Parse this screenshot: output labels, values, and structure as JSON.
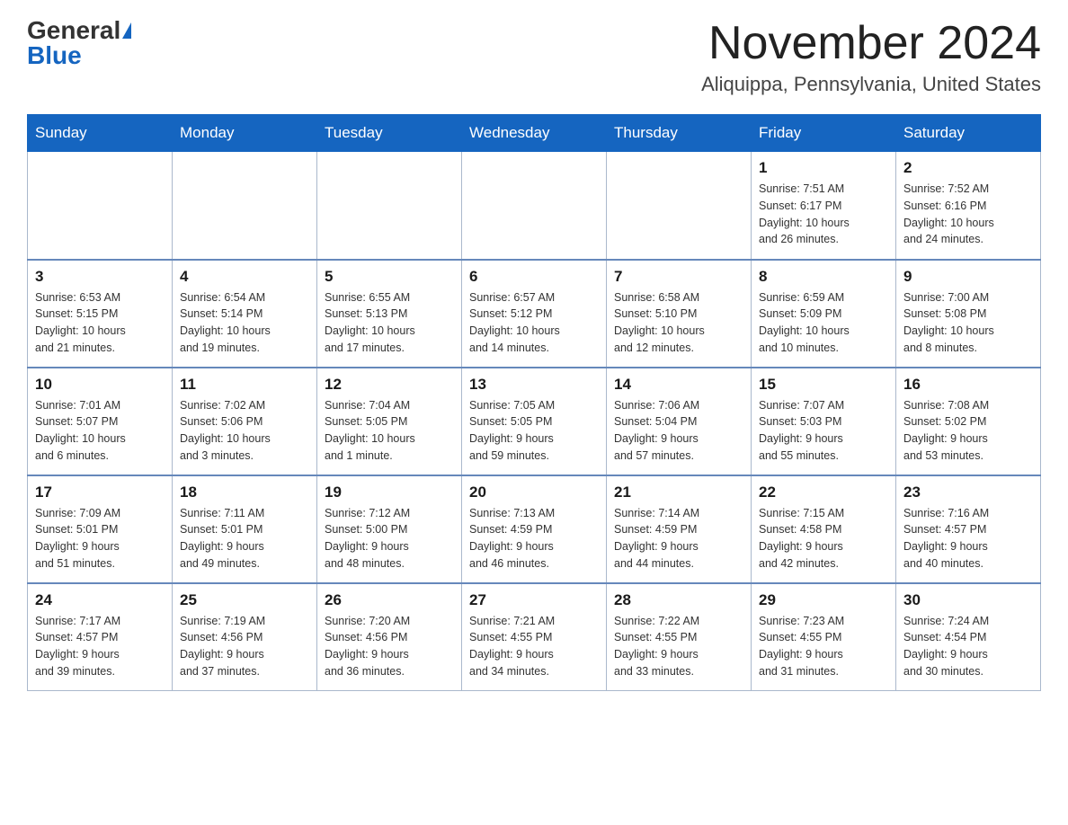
{
  "header": {
    "logo_general": "General",
    "logo_blue": "Blue",
    "month_title": "November 2024",
    "location": "Aliquippa, Pennsylvania, United States"
  },
  "weekdays": [
    "Sunday",
    "Monday",
    "Tuesday",
    "Wednesday",
    "Thursday",
    "Friday",
    "Saturday"
  ],
  "weeks": [
    [
      {
        "day": "",
        "info": ""
      },
      {
        "day": "",
        "info": ""
      },
      {
        "day": "",
        "info": ""
      },
      {
        "day": "",
        "info": ""
      },
      {
        "day": "",
        "info": ""
      },
      {
        "day": "1",
        "info": "Sunrise: 7:51 AM\nSunset: 6:17 PM\nDaylight: 10 hours\nand 26 minutes."
      },
      {
        "day": "2",
        "info": "Sunrise: 7:52 AM\nSunset: 6:16 PM\nDaylight: 10 hours\nand 24 minutes."
      }
    ],
    [
      {
        "day": "3",
        "info": "Sunrise: 6:53 AM\nSunset: 5:15 PM\nDaylight: 10 hours\nand 21 minutes."
      },
      {
        "day": "4",
        "info": "Sunrise: 6:54 AM\nSunset: 5:14 PM\nDaylight: 10 hours\nand 19 minutes."
      },
      {
        "day": "5",
        "info": "Sunrise: 6:55 AM\nSunset: 5:13 PM\nDaylight: 10 hours\nand 17 minutes."
      },
      {
        "day": "6",
        "info": "Sunrise: 6:57 AM\nSunset: 5:12 PM\nDaylight: 10 hours\nand 14 minutes."
      },
      {
        "day": "7",
        "info": "Sunrise: 6:58 AM\nSunset: 5:10 PM\nDaylight: 10 hours\nand 12 minutes."
      },
      {
        "day": "8",
        "info": "Sunrise: 6:59 AM\nSunset: 5:09 PM\nDaylight: 10 hours\nand 10 minutes."
      },
      {
        "day": "9",
        "info": "Sunrise: 7:00 AM\nSunset: 5:08 PM\nDaylight: 10 hours\nand 8 minutes."
      }
    ],
    [
      {
        "day": "10",
        "info": "Sunrise: 7:01 AM\nSunset: 5:07 PM\nDaylight: 10 hours\nand 6 minutes."
      },
      {
        "day": "11",
        "info": "Sunrise: 7:02 AM\nSunset: 5:06 PM\nDaylight: 10 hours\nand 3 minutes."
      },
      {
        "day": "12",
        "info": "Sunrise: 7:04 AM\nSunset: 5:05 PM\nDaylight: 10 hours\nand 1 minute."
      },
      {
        "day": "13",
        "info": "Sunrise: 7:05 AM\nSunset: 5:05 PM\nDaylight: 9 hours\nand 59 minutes."
      },
      {
        "day": "14",
        "info": "Sunrise: 7:06 AM\nSunset: 5:04 PM\nDaylight: 9 hours\nand 57 minutes."
      },
      {
        "day": "15",
        "info": "Sunrise: 7:07 AM\nSunset: 5:03 PM\nDaylight: 9 hours\nand 55 minutes."
      },
      {
        "day": "16",
        "info": "Sunrise: 7:08 AM\nSunset: 5:02 PM\nDaylight: 9 hours\nand 53 minutes."
      }
    ],
    [
      {
        "day": "17",
        "info": "Sunrise: 7:09 AM\nSunset: 5:01 PM\nDaylight: 9 hours\nand 51 minutes."
      },
      {
        "day": "18",
        "info": "Sunrise: 7:11 AM\nSunset: 5:01 PM\nDaylight: 9 hours\nand 49 minutes."
      },
      {
        "day": "19",
        "info": "Sunrise: 7:12 AM\nSunset: 5:00 PM\nDaylight: 9 hours\nand 48 minutes."
      },
      {
        "day": "20",
        "info": "Sunrise: 7:13 AM\nSunset: 4:59 PM\nDaylight: 9 hours\nand 46 minutes."
      },
      {
        "day": "21",
        "info": "Sunrise: 7:14 AM\nSunset: 4:59 PM\nDaylight: 9 hours\nand 44 minutes."
      },
      {
        "day": "22",
        "info": "Sunrise: 7:15 AM\nSunset: 4:58 PM\nDaylight: 9 hours\nand 42 minutes."
      },
      {
        "day": "23",
        "info": "Sunrise: 7:16 AM\nSunset: 4:57 PM\nDaylight: 9 hours\nand 40 minutes."
      }
    ],
    [
      {
        "day": "24",
        "info": "Sunrise: 7:17 AM\nSunset: 4:57 PM\nDaylight: 9 hours\nand 39 minutes."
      },
      {
        "day": "25",
        "info": "Sunrise: 7:19 AM\nSunset: 4:56 PM\nDaylight: 9 hours\nand 37 minutes."
      },
      {
        "day": "26",
        "info": "Sunrise: 7:20 AM\nSunset: 4:56 PM\nDaylight: 9 hours\nand 36 minutes."
      },
      {
        "day": "27",
        "info": "Sunrise: 7:21 AM\nSunset: 4:55 PM\nDaylight: 9 hours\nand 34 minutes."
      },
      {
        "day": "28",
        "info": "Sunrise: 7:22 AM\nSunset: 4:55 PM\nDaylight: 9 hours\nand 33 minutes."
      },
      {
        "day": "29",
        "info": "Sunrise: 7:23 AM\nSunset: 4:55 PM\nDaylight: 9 hours\nand 31 minutes."
      },
      {
        "day": "30",
        "info": "Sunrise: 7:24 AM\nSunset: 4:54 PM\nDaylight: 9 hours\nand 30 minutes."
      }
    ]
  ]
}
